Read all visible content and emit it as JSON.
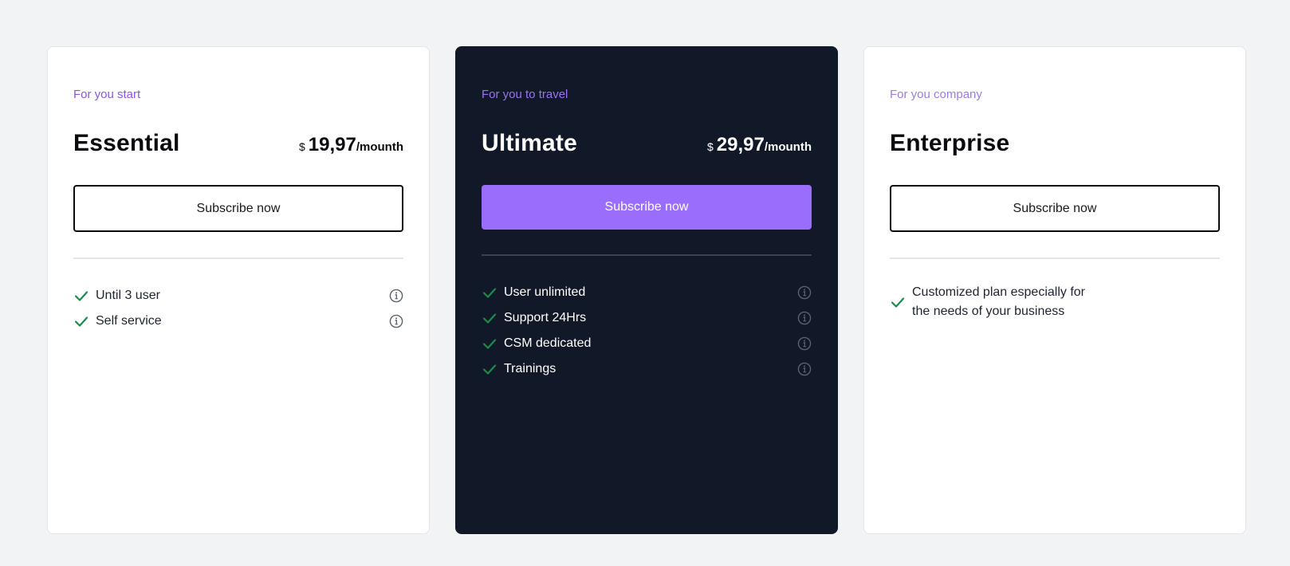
{
  "colors": {
    "page_bg": "#f2f3f5",
    "dark_card": "#111827",
    "accent": "#9b6dfd",
    "check": "#1f8a4c"
  },
  "plans": [
    {
      "tagline": "For you start",
      "name": "Essential",
      "currency": "$",
      "amount": "19,97",
      "period": "/mounth",
      "button": "Subscribe now",
      "features": [
        "Until 3 user",
        "Self service"
      ]
    },
    {
      "tagline": "For you to travel",
      "name": "Ultimate",
      "currency": "$",
      "amount": "29,97",
      "period": "/mounth",
      "button": "Subscribe now",
      "features": [
        "User unlimited",
        "Support 24Hrs",
        "CSM dedicated",
        "Trainings"
      ]
    },
    {
      "tagline": "For you company",
      "name": "Enterprise",
      "button": "Subscribe now",
      "custom_feature": "Customized plan especially for the needs of your business"
    }
  ],
  "icons": {
    "check": "check-icon",
    "info": "info-icon"
  }
}
